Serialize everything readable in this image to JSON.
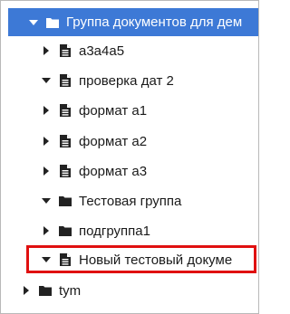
{
  "tree": {
    "items": [
      {
        "label": "Группа документов для дем",
        "type": "folder",
        "expanded": true,
        "selected": true
      },
      {
        "label": "а3а4а5",
        "type": "document",
        "expanded": false
      },
      {
        "label": "проверка дат 2",
        "type": "document",
        "expanded": true
      },
      {
        "label": "формат а1",
        "type": "document",
        "expanded": false
      },
      {
        "label": "формат а2",
        "type": "document",
        "expanded": false
      },
      {
        "label": "формат а3",
        "type": "document",
        "expanded": false
      },
      {
        "label": "Тестовая группа",
        "type": "folder",
        "expanded": true
      },
      {
        "label": "подгруппа1",
        "type": "folder",
        "expanded": false
      },
      {
        "label": "Новый тестовый докуме",
        "type": "document",
        "expanded": true,
        "highlighted": true
      },
      {
        "label": "tym",
        "type": "folder",
        "expanded": false
      }
    ]
  },
  "colors": {
    "selection_bg": "#3d79d6",
    "highlight_border": "#e01010",
    "icon": "#222222"
  }
}
